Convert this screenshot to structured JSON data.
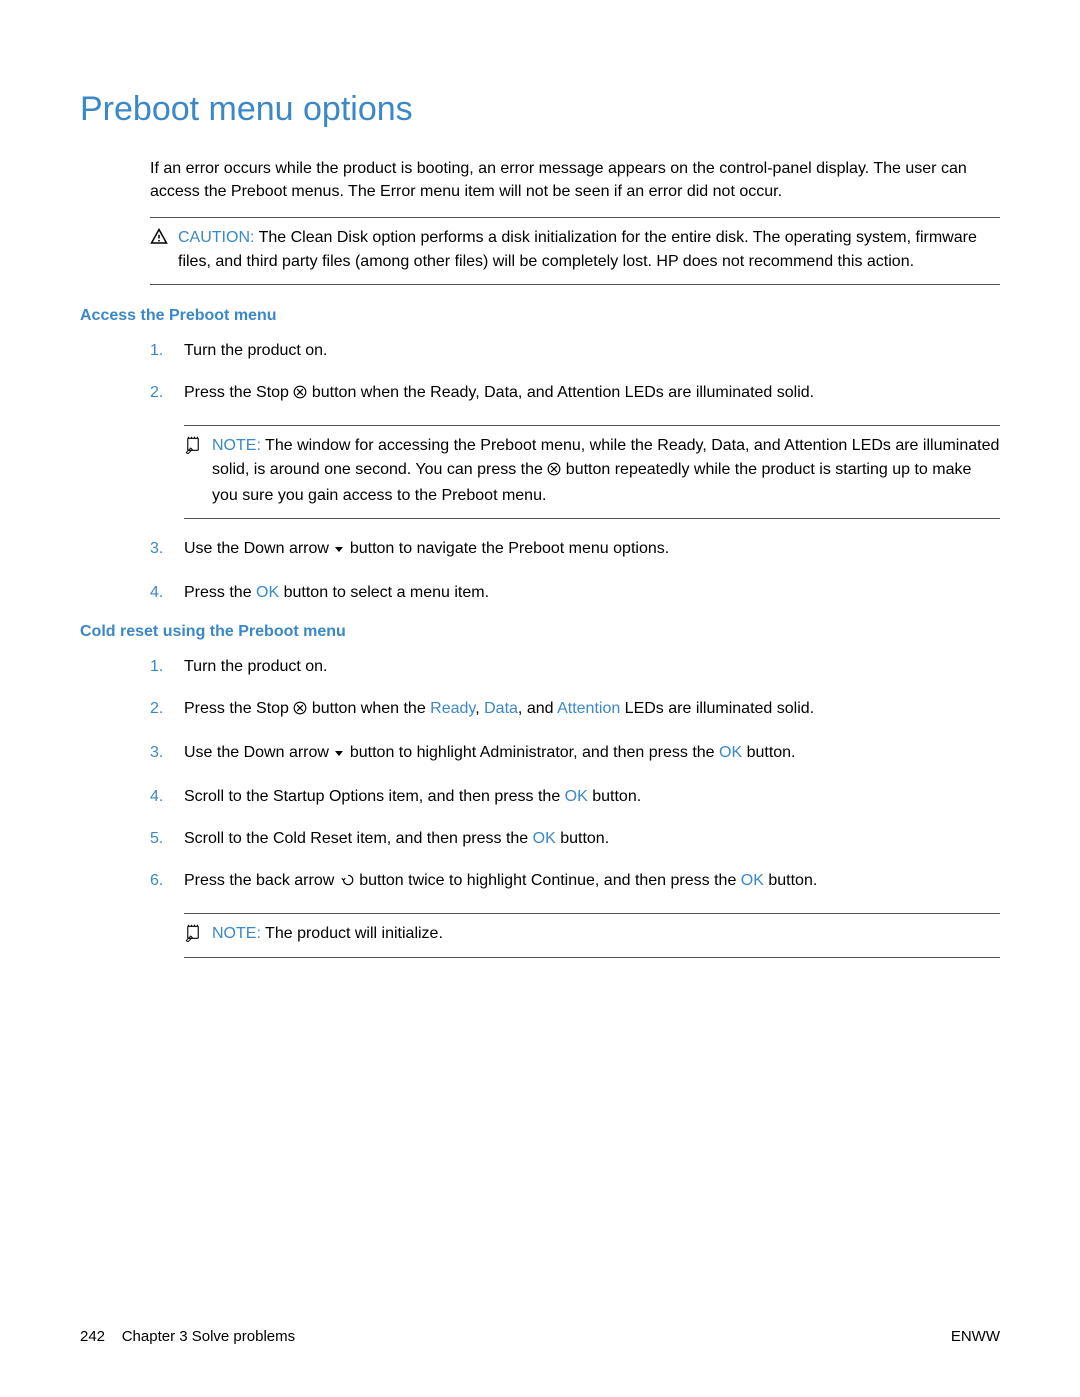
{
  "title": "Preboot menu options",
  "intro": "If an error occurs while the product is booting, an error message appears on the control-panel display. The user can access the Preboot menus. The Error menu item will not be seen if an error did not occur.",
  "caution": {
    "label": "CAUTION:",
    "text_pre": "The ",
    "text_bold": "Clean Disk",
    "text_post": " option performs a disk initialization for the entire disk. The operating system, firmware files, and third party files (among other files) will be completely lost. HP does not recommend this action."
  },
  "section_access": {
    "heading": "Access the Preboot menu",
    "steps": {
      "s1": "Turn the product on.",
      "s2_a": "Press the ",
      "s2_b": "Stop",
      "s2_c": " button when the ",
      "s2_d": "Ready",
      "s2_e": ", ",
      "s2_f": "Data",
      "s2_g": ", and ",
      "s2_h": "Attention",
      "s2_i": " LEDs are illuminated solid.",
      "s3_a": "Use the Down arrow ",
      "s3_b": " button to navigate the ",
      "s3_c": "Preboot",
      "s3_d": " menu options.",
      "s4_a": "Press the ",
      "s4_ok": "OK",
      "s4_b": " button to select a menu item."
    },
    "note": {
      "label": "NOTE:",
      "text_a": "The window for accessing the Preboot menu, while the Ready, Data, and  Attention LEDs are illuminated solid, is around one second. You can press the ",
      "text_b": " button repeatedly while the product is starting up to make you sure you gain access to the Preboot menu."
    }
  },
  "section_cold": {
    "heading": "Cold reset using the Preboot menu",
    "steps": {
      "s1": "Turn the product on.",
      "s2_a": "Press the ",
      "s2_b": "Stop",
      "s2_c": " button when the ",
      "s2_ready": "Ready",
      "s2_comma1": ", ",
      "s2_data": "Data",
      "s2_comma2": ", and ",
      "s2_att": "Attention",
      "s2_end": " LEDs are illuminated solid.",
      "s3_a": "Use the ",
      "s3_b": "Down",
      "s3_c": " arrow ",
      "s3_d": " button to highlight ",
      "s3_e": "Administrator",
      "s3_f": ", and then press the ",
      "s3_ok": "OK",
      "s3_g": " button.",
      "s4_a": "Scroll to the ",
      "s4_b": "Startup Options",
      "s4_c": " item, and then press the ",
      "s4_ok": "OK",
      "s4_d": " button.",
      "s5_a": "Scroll to the ",
      "s5_b": "Cold Reset",
      "s5_c": " item, and then press the ",
      "s5_ok": "OK",
      "s5_d": " button.",
      "s6_a": "Press the back arrow ",
      "s6_b": " button twice to highlight ",
      "s6_c": "Continue",
      "s6_d": ", and then press the ",
      "s6_ok": "OK",
      "s6_e": " button."
    },
    "note": {
      "label": "NOTE:",
      "text": "The product will initialize."
    }
  },
  "footer": {
    "page": "242",
    "chapter": "Chapter 3   Solve problems",
    "right": "ENWW"
  },
  "nums": {
    "n1": "1.",
    "n2": "2.",
    "n3": "3.",
    "n4": "4.",
    "n5": "5.",
    "n6": "6."
  }
}
